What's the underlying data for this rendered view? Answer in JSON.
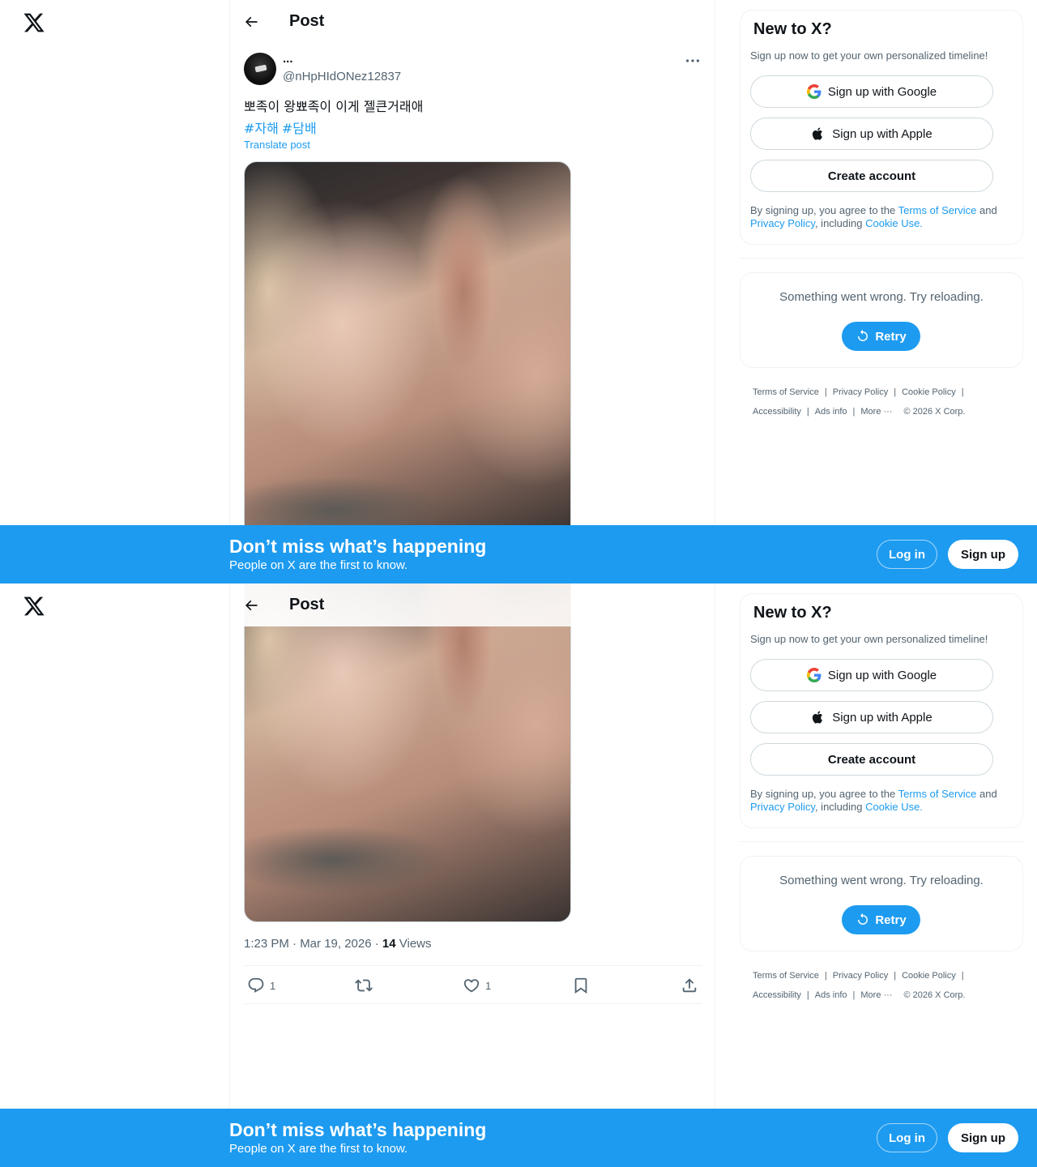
{
  "app": {
    "logo": "x-logo-icon"
  },
  "header": {
    "title": "Post"
  },
  "post": {
    "display_name": "...",
    "handle": "@nHpHIdONez12837",
    "text": "뽀족이 왕뾰족이 이게 젤큰거래애",
    "hashtags": [
      "#자해",
      "#담배"
    ],
    "translate": "Translate post",
    "timestamp": "1:23 PM · Mar 19, 2026 · ",
    "views_count": "14",
    "views_label": " Views",
    "replies": "1",
    "likes": "1"
  },
  "signup": {
    "title": "New to X?",
    "subtitle": "Sign up now to get your own personalized timeline!",
    "google": "Sign up with Google",
    "apple": "Sign up with Apple",
    "create": "Create account",
    "legal_prefix": "By signing up, you agree to the ",
    "legal_tos": "Terms of Service",
    "legal_and": " and ",
    "legal_privacy": "Privacy Policy",
    "legal_including": ", including ",
    "legal_cookie": "Cookie Use."
  },
  "error": {
    "message": "Something went wrong. Try reloading.",
    "retry": "Retry"
  },
  "footer": {
    "tos": "Terms of Service",
    "privacy": "Privacy Policy",
    "cookie": "Cookie Policy",
    "accessibility": "Accessibility",
    "ads": "Ads info",
    "more": "More ···",
    "copyright": "© 2026 X Corp."
  },
  "banner": {
    "title": "Don’t miss what’s happening",
    "subtitle": "People on X are the first to know.",
    "login": "Log in",
    "signup": "Sign up"
  },
  "colors": {
    "accent": "#1d9bf0",
    "text": "#0f1419",
    "muted": "#536471",
    "border": "#eff3f4"
  }
}
